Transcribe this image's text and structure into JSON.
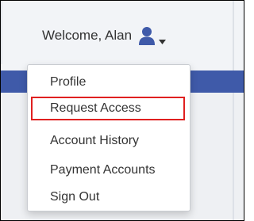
{
  "header": {
    "welcome_text": "Welcome, Alan",
    "user_icon": "user-icon",
    "caret_icon": "chevron-down-icon"
  },
  "dropdown": {
    "items": [
      {
        "label": "Profile"
      },
      {
        "label": "Request Access",
        "highlighted": true
      },
      {
        "label": "Account History"
      },
      {
        "label": "Payment Accounts"
      },
      {
        "label": "Sign Out"
      }
    ],
    "highlight_color": "#e02020"
  },
  "colors": {
    "nav_bar": "#3f5aa9",
    "header_bg": "#f2f4f7",
    "text": "#333333"
  }
}
